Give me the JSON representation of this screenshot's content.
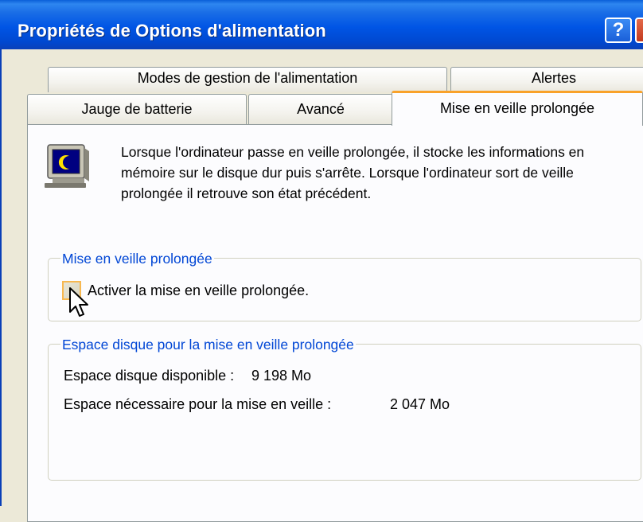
{
  "window": {
    "title": "Propriétés de Options d'alimentation",
    "help_label": "?"
  },
  "tabs": {
    "row1": [
      {
        "label": "Modes de gestion de l'alimentation"
      },
      {
        "label": "Alertes"
      }
    ],
    "row2": [
      {
        "label": "Jauge de batterie"
      },
      {
        "label": "Avancé"
      },
      {
        "label": "Mise en veille prolongée",
        "active": true
      }
    ]
  },
  "panel": {
    "description": "Lorsque l'ordinateur passe en veille prolongée, il stocke les informations en mémoire sur le disque dur puis s'arrête. Lorsque l'ordinateur sort de veille prolongée il retrouve son état précédent.",
    "icon": "monitor-moon-icon",
    "hibernate_group": {
      "title": "Mise en veille prolongée",
      "checkbox_label": "Activer la mise en veille prolongée.",
      "checked": false
    },
    "disk_group": {
      "title": "Espace disque pour la mise en veille prolongée",
      "available_label": "Espace disque disponible :",
      "available_value": "9 198 Mo",
      "required_label": "Espace nécessaire pour la mise en veille :",
      "required_value": "2 047 Mo"
    }
  },
  "colors": {
    "titlebar": "#0055e5",
    "group_label": "#0046d5",
    "active_tab_accent": "#f9a22a",
    "window_bg": "#ece9d8"
  }
}
